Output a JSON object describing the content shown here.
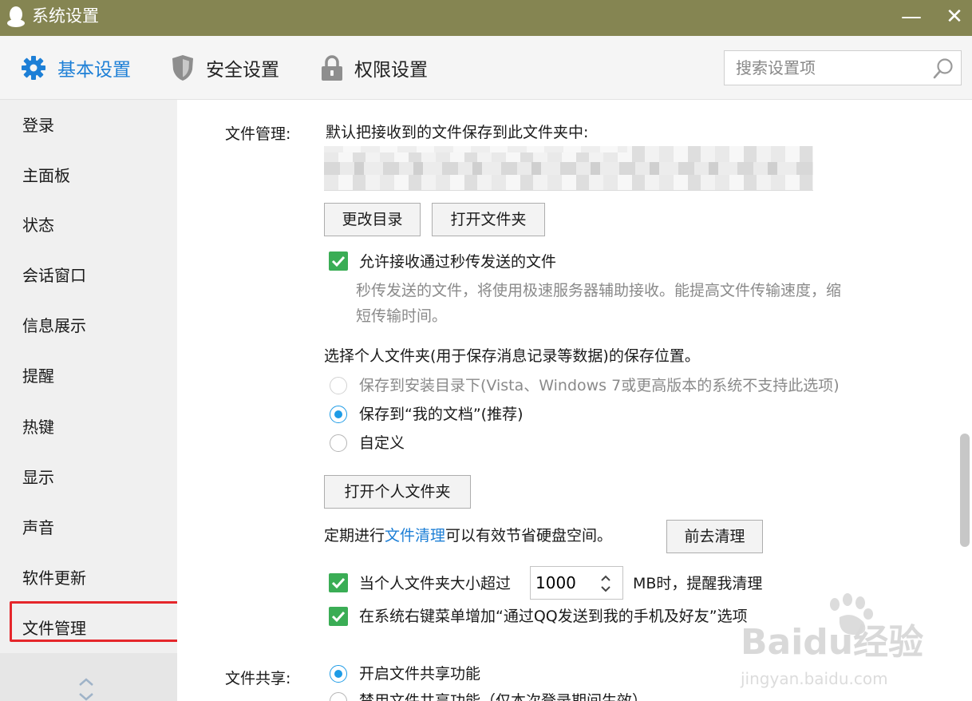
{
  "window": {
    "title": "系统设置",
    "minimize_glyph": "—",
    "close_glyph": "✕"
  },
  "tabs": [
    {
      "label": "基本设置",
      "icon": "gear-icon",
      "active": true
    },
    {
      "label": "安全设置",
      "icon": "shield-icon",
      "active": false
    },
    {
      "label": "权限设置",
      "icon": "lock-icon",
      "active": false
    }
  ],
  "search": {
    "placeholder": "搜索设置项",
    "value": ""
  },
  "sidebar": {
    "items": [
      {
        "label": "登录"
      },
      {
        "label": "主面板"
      },
      {
        "label": "状态"
      },
      {
        "label": "会话窗口"
      },
      {
        "label": "信息展示"
      },
      {
        "label": "提醒"
      },
      {
        "label": "热键"
      },
      {
        "label": "显示"
      },
      {
        "label": "声音"
      },
      {
        "label": "软件更新"
      },
      {
        "label": "文件管理"
      }
    ],
    "active_item": "文件管理"
  },
  "file_management": {
    "section_label": "文件管理:",
    "default_folder_text": "默认把接收到的文件保存到此文件夹中:",
    "change_dir_button": "更改目录",
    "open_folder_button": "打开文件夹",
    "allow_instant_transfer": {
      "checked": true,
      "label": "允许接收通过秒传发送的文件",
      "hint": "秒传发送的文件，将使用极速服务器辅助接收。能提高文件传输速度，缩短传输时间。"
    },
    "personal_folder_title": "选择个人文件夹(用于保存消息记录等数据)的保存位置。",
    "save_options": [
      {
        "label": "保存到安装目录下(Vista、Windows 7或更高版本的系统不支持此选项)",
        "checked": false,
        "disabled": true
      },
      {
        "label": "保存到“我的文档”(推荐)",
        "checked": true,
        "disabled": false
      },
      {
        "label": "自定义",
        "checked": false,
        "disabled": false
      }
    ],
    "open_personal_folder_button": "打开个人文件夹",
    "cleanup": {
      "text_before": "定期进行",
      "link": "文件清理",
      "text_after": "可以有效节省硬盘空间。",
      "button": "前去清理"
    },
    "size_reminder": {
      "checked": true,
      "label_before": "当个人文件夹大小超过",
      "value": "1000",
      "label_after": "MB时，提醒我清理"
    },
    "context_menu": {
      "checked": true,
      "label": "在系统右键菜单增加“通过QQ发送到我的手机及好友”选项"
    }
  },
  "file_sharing": {
    "section_label": "文件共享:",
    "options": [
      {
        "label": "开启文件共享功能",
        "checked": true
      },
      {
        "label": "禁用文件共享功能（仅本次登录期间生效）",
        "checked": false
      }
    ]
  },
  "watermark": {
    "brand": "Baidu经验",
    "url": "jingyan.baidu.com"
  },
  "colors": {
    "titlebar": "#858552",
    "accent": "#1d7fd6",
    "checkbox": "#3aad55",
    "highlight_frame": "#e5262b"
  }
}
